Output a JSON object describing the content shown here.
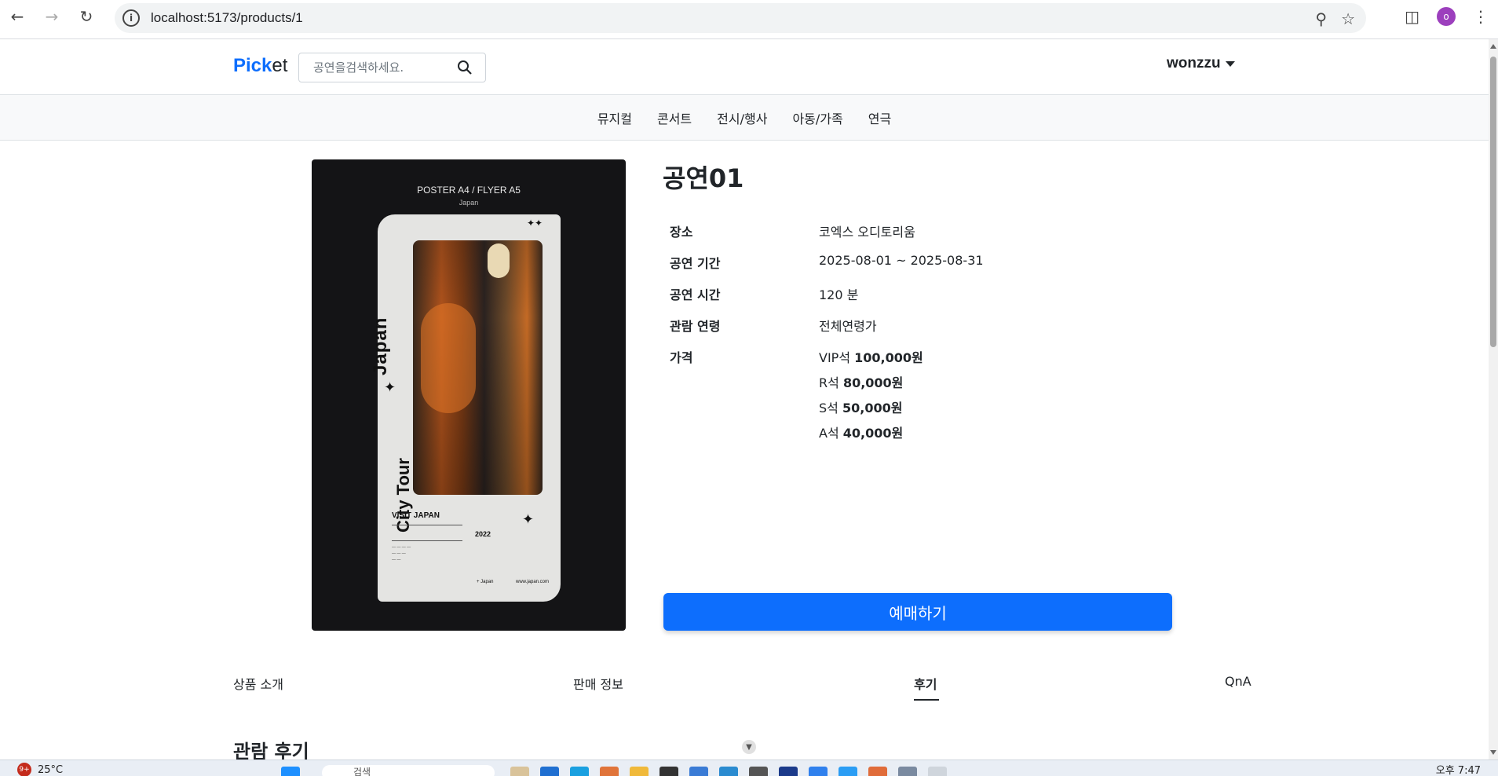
{
  "browser": {
    "url": "localhost:5173/products/1",
    "profile_initial": "o"
  },
  "header": {
    "logo_pick": "Pick",
    "logo_et": "et",
    "search_placeholder": "공연을검색하세요.",
    "username": "wonzzu"
  },
  "categories": [
    "뮤지컬",
    "콘서트",
    "전시/행사",
    "아동/가족",
    "연극"
  ],
  "poster": {
    "head": "POSTER A4 / FLYER A5",
    "sub": "Japan",
    "title_vertical": "Japan",
    "subtitle_vertical": "City Tour",
    "visit": "VISIT JAPAN",
    "year": "2022",
    "footer_left": "+ Japan",
    "footer_right": "www.japan.com"
  },
  "product": {
    "title": "공연01",
    "rows": [
      {
        "label": "장소",
        "value": "코엑스 오디토리움"
      },
      {
        "label": "공연 기간",
        "value": "2025-08-01 ~ 2025-08-31"
      },
      {
        "label": "공연 시간",
        "value": "120 분"
      },
      {
        "label": "관람 연령",
        "value": "전체연령가"
      }
    ],
    "price_label": "가격",
    "prices": [
      {
        "seat": "VIP석",
        "amount": "100,000원"
      },
      {
        "seat": "R석",
        "amount": "80,000원"
      },
      {
        "seat": "S석",
        "amount": "50,000원"
      },
      {
        "seat": "A석",
        "amount": "40,000원"
      }
    ],
    "book_label": "예매하기"
  },
  "tabs": [
    {
      "label": "상품 소개",
      "active": false
    },
    {
      "label": "판매 정보",
      "active": false
    },
    {
      "label": "후기",
      "active": true
    },
    {
      "label": "QnA",
      "active": false
    }
  ],
  "section_title": "관람 후기",
  "taskbar": {
    "notifications": "9+",
    "temperature": "25°C",
    "search_text": "검색",
    "clock": "오후 7:47"
  },
  "colors": {
    "primary": "#0d6efd",
    "nav_bg": "#f8f9fa",
    "poster_bg": "#141416"
  }
}
